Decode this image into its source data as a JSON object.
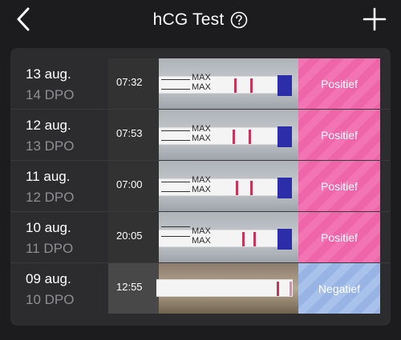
{
  "header": {
    "title": "hCG Test",
    "back_icon": "chevron-left-icon",
    "help_icon": "question-circle-icon",
    "add_icon": "plus-icon"
  },
  "entries": [
    {
      "date": "13 aug.",
      "dpo": "14 DPO",
      "time": "07:32",
      "result": "Positief",
      "status": "positive"
    },
    {
      "date": "12 aug.",
      "dpo": "13 DPO",
      "time": "07:53",
      "result": "Positief",
      "status": "positive"
    },
    {
      "date": "11 aug.",
      "dpo": "12 DPO",
      "time": "07:00",
      "result": "Positief",
      "status": "positive"
    },
    {
      "date": "10 aug.",
      "dpo": "11 DPO",
      "time": "20:05",
      "result": "Positief",
      "status": "positive"
    },
    {
      "date": "09 aug.",
      "dpo": "10 DPO",
      "time": "12:55",
      "result": "Negatief",
      "status": "negative"
    }
  ],
  "strip_text": "MAX",
  "colors": {
    "background": "#1c1c1e",
    "card": "#2c2c2e",
    "positive": "#f274b3",
    "negative": "#a8c2ec",
    "test_line": "#c6365a"
  }
}
